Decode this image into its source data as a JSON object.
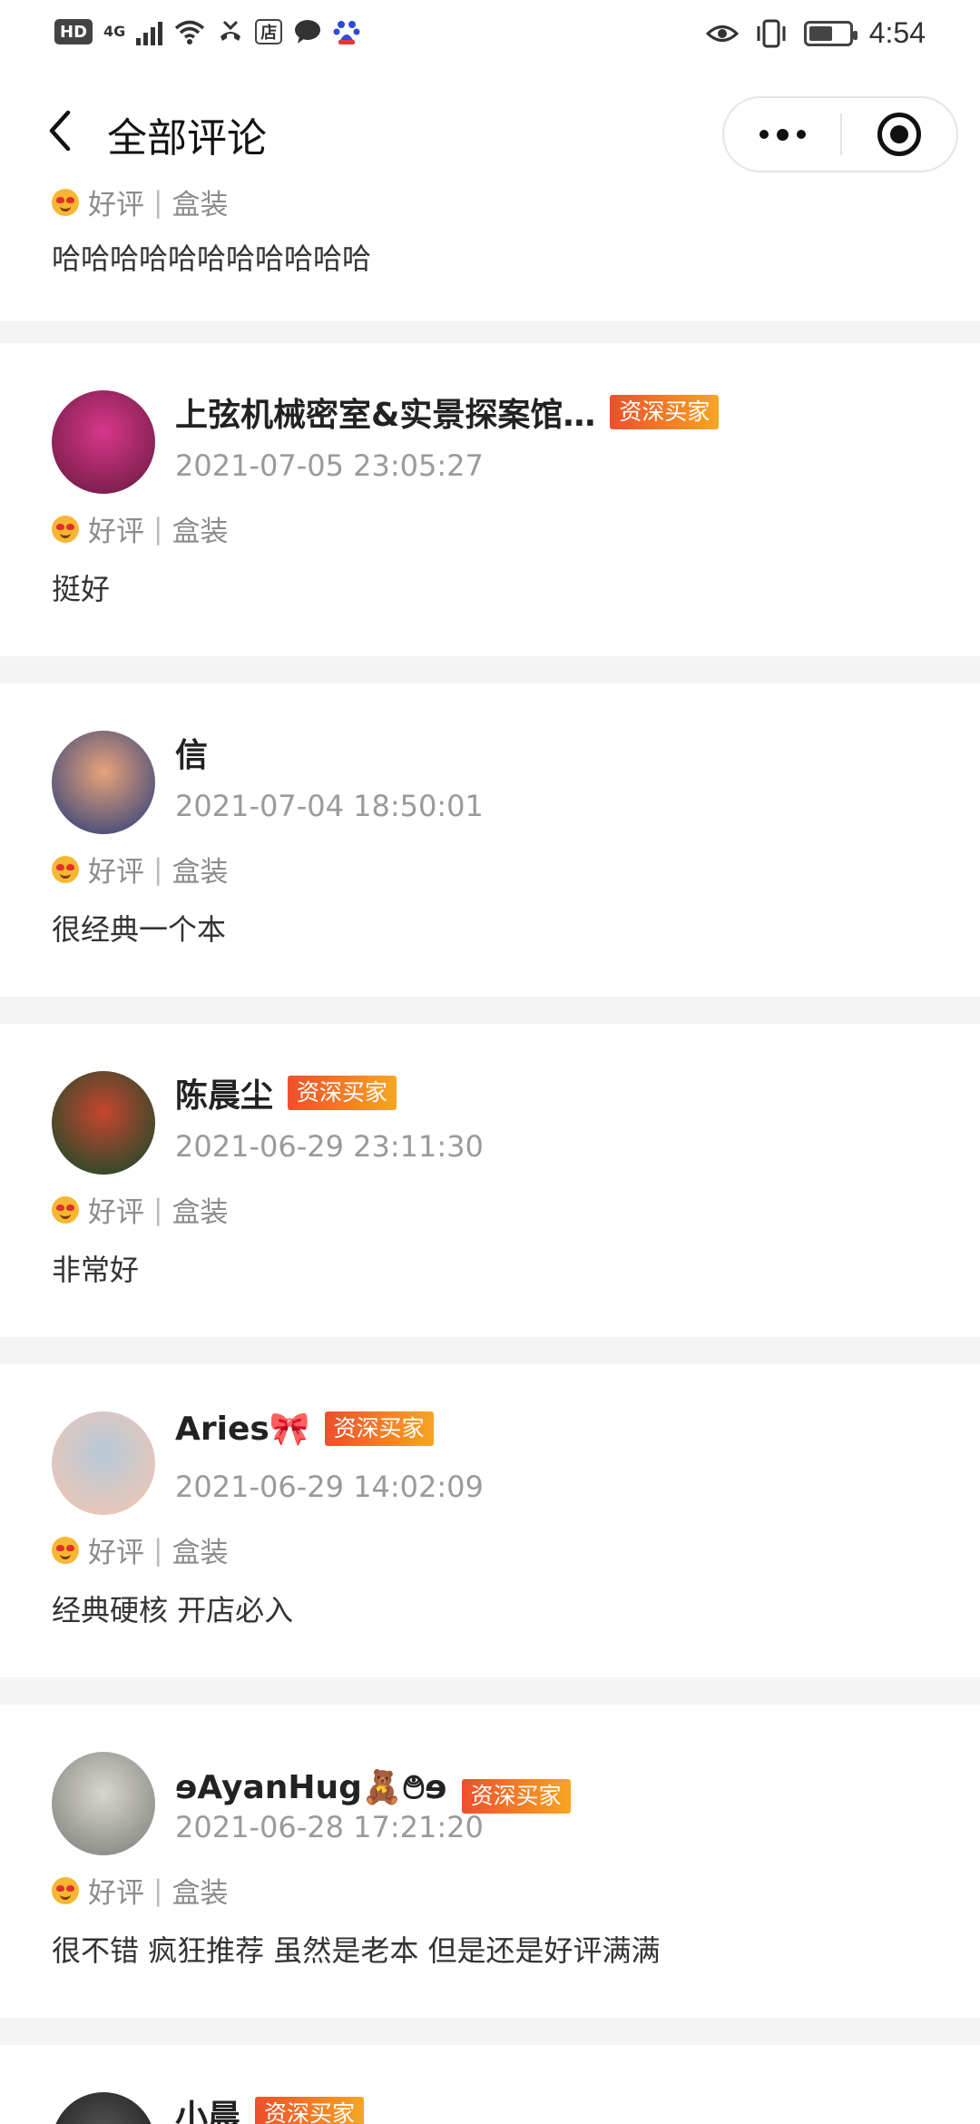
{
  "status_bar": {
    "hd": "HD",
    "network": "4G",
    "store_icon_label": "店",
    "time": "4:54",
    "battery_level": 0.6
  },
  "header": {
    "title": "全部评论",
    "icons": [
      "back-arrow-icon",
      "more-dots-icon",
      "target-close-icon"
    ]
  },
  "partial_top": {
    "rating": "好评",
    "separator": "|",
    "spec": "盒装",
    "comment": "哈哈哈哈哈哈哈哈哈哈哈"
  },
  "reviews": [
    {
      "name": "上弦机械密室&实景探案馆…",
      "badge": "资深买家",
      "time": "2021-07-05 23:05:27",
      "rating": "好评",
      "separator": "|",
      "spec": "盒装",
      "comment": "挺好",
      "avatar_colors": [
        "#7b1f4e",
        "#d9368b"
      ]
    },
    {
      "name": "信",
      "badge": "",
      "time": "2021-07-04 18:50:01",
      "rating": "好评",
      "separator": "|",
      "spec": "盒装",
      "comment": "很经典一个本",
      "avatar_colors": [
        "#4a4f7a",
        "#e8a37a"
      ]
    },
    {
      "name": "陈晨尘",
      "badge": "资深买家",
      "time": "2021-06-29 23:11:30",
      "rating": "好评",
      "separator": "|",
      "spec": "盒装",
      "comment": "非常好",
      "avatar_colors": [
        "#2f4a2a",
        "#c8452f"
      ]
    },
    {
      "name": "Aries🎀",
      "badge": "资深买家",
      "time": "2021-06-29 14:02:09",
      "rating": "好评",
      "separator": "|",
      "spec": "盒装",
      "comment": "经典硬核 开店必入",
      "avatar_colors": [
        "#e9c7b8",
        "#b7c8d8"
      ]
    },
    {
      "name": "ɘAyanHug🧸࿉ɘ",
      "badge": "资深买家",
      "time": "2021-06-28 17:21:20",
      "rating": "好评",
      "separator": "|",
      "spec": "盒装",
      "comment": "很不错 疯狂推荐 虽然是老本 但是还是好评满满",
      "avatar_colors": [
        "#8d8d88",
        "#d8d6cf"
      ]
    },
    {
      "name": "小晨",
      "badge": "资深买家",
      "time": "",
      "rating": "",
      "separator": "",
      "spec": "",
      "comment": "",
      "avatar_colors": [
        "#222222",
        "#555555"
      ]
    }
  ]
}
